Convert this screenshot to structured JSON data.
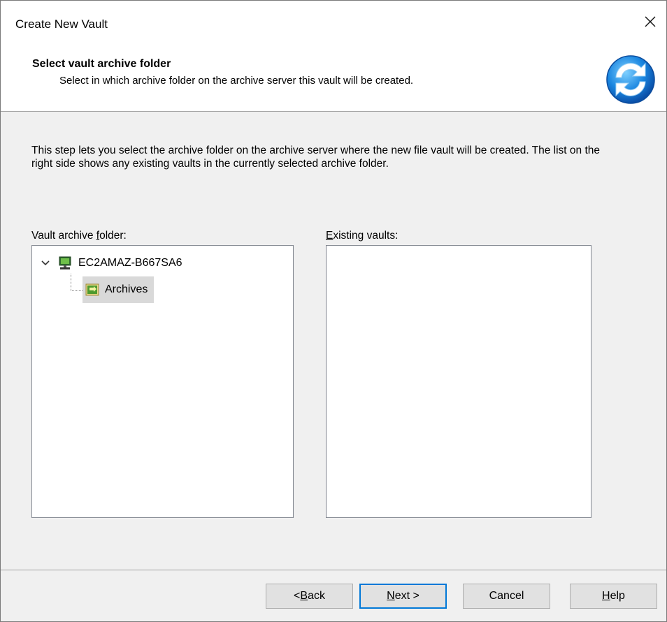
{
  "window": {
    "title": "Create New Vault"
  },
  "header": {
    "title": "Select vault archive folder",
    "subtitle": "Select in which archive folder on the archive server this vault will be created.",
    "icon": "sync-arrows-icon"
  },
  "body": {
    "description": "This step lets you select the archive folder on the archive server where the new file vault will be created. The list on the right side shows any existing vaults in the currently selected archive folder."
  },
  "folder_panel": {
    "label_pre": "Vault archive ",
    "label_mnemonic": "f",
    "label_post": "older:",
    "tree": {
      "root": {
        "label": "EC2AMAZ-B667SA6",
        "icon": "server-icon",
        "expanded": true
      },
      "children": [
        {
          "label": "Archives",
          "icon": "archive-folder-icon",
          "selected": true
        }
      ]
    }
  },
  "vaults_panel": {
    "label_mnemonic": "E",
    "label_post": "xisting vaults:",
    "items": []
  },
  "buttons": {
    "back_pre": "< ",
    "back_mnemonic": "B",
    "back_post": "ack",
    "next_mnemonic": "N",
    "next_post": "ext >",
    "cancel": "Cancel",
    "help_mnemonic": "H",
    "help_post": "elp"
  },
  "colors": {
    "focus_border": "#0078d7",
    "selection_bg": "#d9d9d9",
    "dialog_bg": "#f0f0f0"
  }
}
